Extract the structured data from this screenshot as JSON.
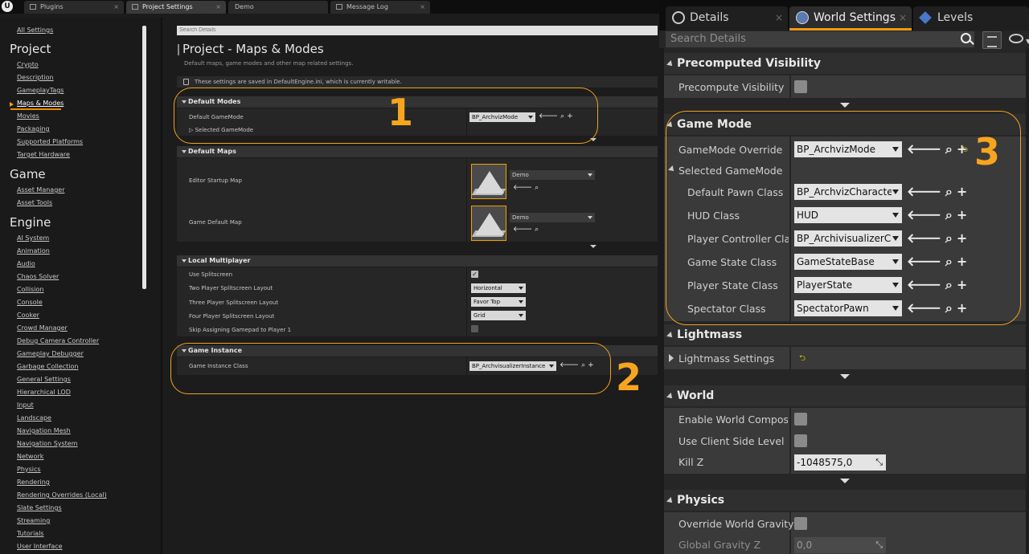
{
  "left_window": {
    "tabs": [
      "Plugins",
      "Project Settings",
      "Demo",
      "Message Log"
    ],
    "active_tab": "Project Settings",
    "sidebar": {
      "all_settings": "All Settings",
      "sections": [
        {
          "title": "Project",
          "items": [
            "Crypto",
            "Description",
            "GameplayTags",
            "Maps & Modes",
            "Movies",
            "Packaging",
            "Supported Platforms",
            "Target Hardware"
          ]
        },
        {
          "title": "Game",
          "items": [
            "Asset Manager",
            "Asset Tools"
          ]
        },
        {
          "title": "Engine",
          "items": [
            "AI System",
            "Animation",
            "Audio",
            "Chaos Solver",
            "Collision",
            "Console",
            "Cooker",
            "Crowd Manager",
            "Debug Camera Controller",
            "Gameplay Debugger",
            "Garbage Collection",
            "General Settings",
            "Hierarchical LOD",
            "Input",
            "Landscape",
            "Navigation Mesh",
            "Navigation System",
            "Network",
            "Physics",
            "Rendering",
            "Rendering Overrides (Local)",
            "Slate Settings",
            "Streaming",
            "Tutorials",
            "User Interface"
          ]
        }
      ],
      "selected_item": "Maps & Modes"
    },
    "search_placeholder": "Search Details",
    "page_title": "Project - Maps & Modes",
    "page_subtitle": "Default maps, game modes and other map related settings.",
    "saved_notice": "These settings are saved in DefaultEngine.ini, which is currently writable.",
    "default_modes": {
      "title": "Default Modes",
      "default_gamemode_label": "Default GameMode",
      "default_gamemode_value": "BP_ArchvizMode",
      "selected_gamemode_label": "Selected GameMode"
    },
    "default_maps": {
      "title": "Default Maps",
      "editor_startup_label": "Editor Startup Map",
      "editor_startup_value": "Demo",
      "game_default_label": "Game Default Map",
      "game_default_value": "Demo"
    },
    "local_multiplayer": {
      "title": "Local Multiplayer",
      "use_splitscreen_label": "Use Splitscreen",
      "use_splitscreen_checked": true,
      "two_player_label": "Two Player Splitscreen Layout",
      "two_player_value": "Horizontal",
      "three_player_label": "Three Player Splitscreen Layout",
      "three_player_value": "Favor Top",
      "four_player_label": "Four Player Splitscreen Layout",
      "four_player_value": "Grid",
      "skip_gamepad_label": "Skip Assigning Gamepad to Player 1",
      "skip_gamepad_checked": false
    },
    "game_instance": {
      "title": "Game Instance",
      "class_label": "Game Instance Class",
      "class_value": "BP_ArchvisualizerInstance"
    },
    "annotations": [
      "1",
      "2"
    ]
  },
  "right_window": {
    "tabs": [
      "Details",
      "World Settings",
      "Levels"
    ],
    "active_tab": "World Settings",
    "search_placeholder": "Search Details",
    "precomputed_visibility": {
      "title": "Precomputed Visibility",
      "precompute_label": "Precompute Visibility"
    },
    "game_mode": {
      "title": "Game Mode",
      "override_label": "GameMode Override",
      "override_value": "BP_ArchvizMode",
      "selected_label": "Selected GameMode",
      "rows": [
        {
          "label": "Default Pawn Class",
          "value": "BP_ArchvizCharacter"
        },
        {
          "label": "HUD Class",
          "value": "HUD"
        },
        {
          "label": "Player Controller Class",
          "value": "BP_ArchivisualizerCo"
        },
        {
          "label": "Game State Class",
          "value": "GameStateBase"
        },
        {
          "label": "Player State Class",
          "value": "PlayerState"
        },
        {
          "label": "Spectator Class",
          "value": "SpectatorPawn"
        }
      ]
    },
    "lightmass": {
      "title": "Lightmass",
      "settings_label": "Lightmass Settings"
    },
    "world": {
      "title": "World",
      "composition_label": "Enable World Compositio",
      "client_side_label": "Use Client Side Level Str",
      "kill_z_label": "Kill Z",
      "kill_z_value": "-1048575,0"
    },
    "physics": {
      "title": "Physics",
      "override_gravity_label": "Override World Gravity",
      "global_gravity_label": "Global Gravity Z",
      "global_gravity_value": "0,0"
    },
    "annotation": "3"
  },
  "colors": {
    "accent_orange": "#f2a21d",
    "panel_dark": "#1c1c1c",
    "panel_right": "#262626"
  }
}
